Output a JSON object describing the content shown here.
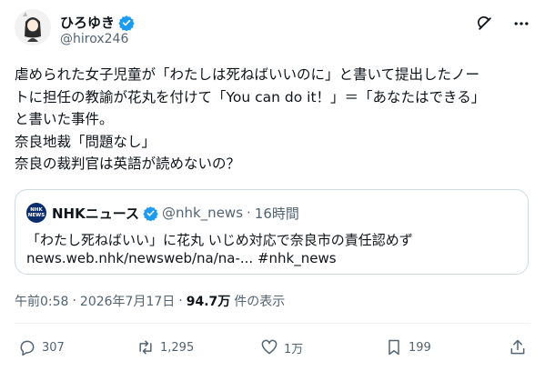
{
  "author": {
    "display_name": "ひろゆき",
    "handle": "@hirox246",
    "verified_icon": "verified-badge-icon"
  },
  "header_icons": [
    "grok-icon",
    "more-icon"
  ],
  "tweet": {
    "lines": [
      "虐められた女子児童が「わたしは死ねばいいのに」と書いて提出したノー",
      "トに担任の教諭が花丸を付けて「You can do it！」＝「あなたはできる」",
      "と書いた事件。",
      "奈良地裁「問題なし」",
      "奈良の裁判官は英語が読めないの？"
    ]
  },
  "quote": {
    "logo_top": "NHK",
    "logo_bottom": "NEWS",
    "name": "NHKニュース",
    "handle": "@nhk_news",
    "separator": "·",
    "time": "16時間",
    "text_line1": "「わたし死ねばいい」に花丸 いじめ対応で奈良市の責任認めず",
    "text_line2": "news.web.nhk/newsweb/na/na-... #nhk_news"
  },
  "meta": {
    "time": "午前0:58",
    "separator": "·",
    "date": "2026年7月17日",
    "separator2": "·",
    "views": "94.7万",
    "views_suffix": "件の表示"
  },
  "actions": {
    "replies": "307",
    "reposts": "1,295",
    "likes": "1万",
    "bookmarks": "199"
  },
  "colors": {
    "verified": "#1d9bf0",
    "text": "#0f1419",
    "secondary": "#536471",
    "border": "#cfd9de"
  }
}
